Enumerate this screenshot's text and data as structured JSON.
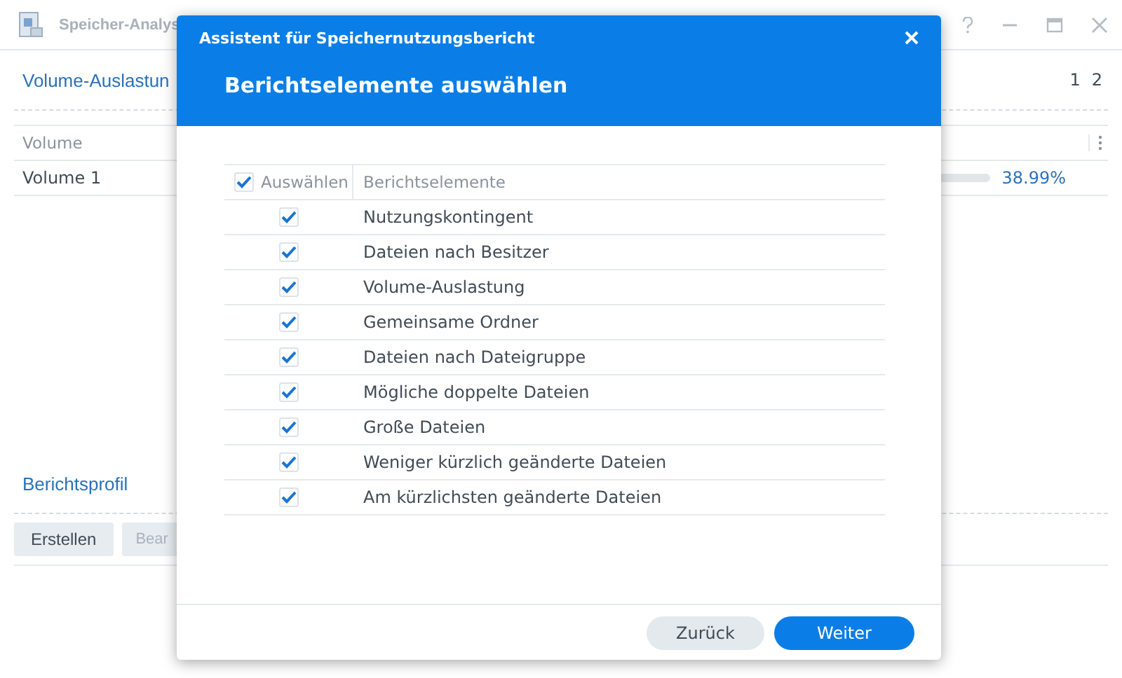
{
  "window": {
    "title": "Speicher-Analys",
    "pager": [
      "1",
      "2"
    ]
  },
  "volume_section": {
    "heading": "Volume-Auslastun",
    "table": {
      "columns": [
        "Volume"
      ],
      "rows": [
        {
          "name": "Volume 1",
          "reading": "38.99%"
        }
      ]
    }
  },
  "profile_section": {
    "heading": "Berichtsprofil",
    "buttons": [
      {
        "label": "Erstellen",
        "disabled": false
      },
      {
        "label": "Bear",
        "disabled": true
      }
    ]
  },
  "dialog": {
    "title": "Assistent für Speichernutzungsbericht",
    "heading": "Berichtselemente auswählen",
    "table": {
      "select_all": {
        "label": "Auswählen",
        "checked": true
      },
      "column": "Berichtselemente",
      "rows": [
        {
          "label": "Nutzungskontingent",
          "checked": true
        },
        {
          "label": "Dateien nach Besitzer",
          "checked": true
        },
        {
          "label": "Volume-Auslastung",
          "checked": true
        },
        {
          "label": "Gemeinsame Ordner",
          "checked": true
        },
        {
          "label": "Dateien nach Dateigruppe",
          "checked": true
        },
        {
          "label": "Mögliche doppelte Dateien",
          "checked": true
        },
        {
          "label": "Große Dateien",
          "checked": true
        },
        {
          "label": "Weniger kürzlich geänderte Dateien",
          "checked": true
        },
        {
          "label": "Am kürzlichsten geänderte Dateien",
          "checked": true
        }
      ]
    },
    "buttons": [
      {
        "label": "Zurück",
        "kind": "secondary"
      },
      {
        "label": "Weiter",
        "kind": "primary"
      }
    ]
  }
}
